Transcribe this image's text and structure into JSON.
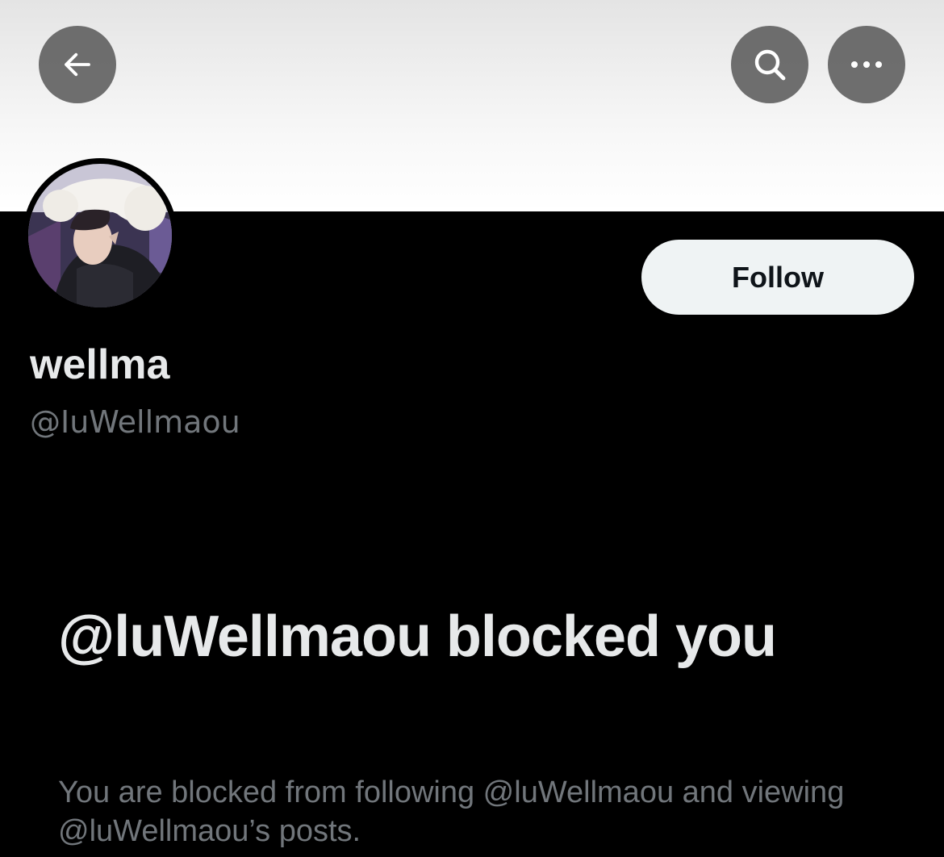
{
  "header": {
    "back_icon": "arrow-left-icon",
    "search_icon": "search-icon",
    "more_icon": "more-horizontal-icon"
  },
  "profile": {
    "display_name": "wellma",
    "handle": "@IuWellmaou",
    "follow_label": "Follow"
  },
  "blocked": {
    "title": "@luWellmaou blocked you",
    "description": "You are blocked from following @luWellmaou and viewing @luWellmaou’s posts."
  },
  "colors": {
    "background": "#000000",
    "primary_text": "#e7e9ea",
    "secondary_text": "#71767b",
    "follow_button_bg": "#eff3f4",
    "header_button_bg": "#666666"
  }
}
